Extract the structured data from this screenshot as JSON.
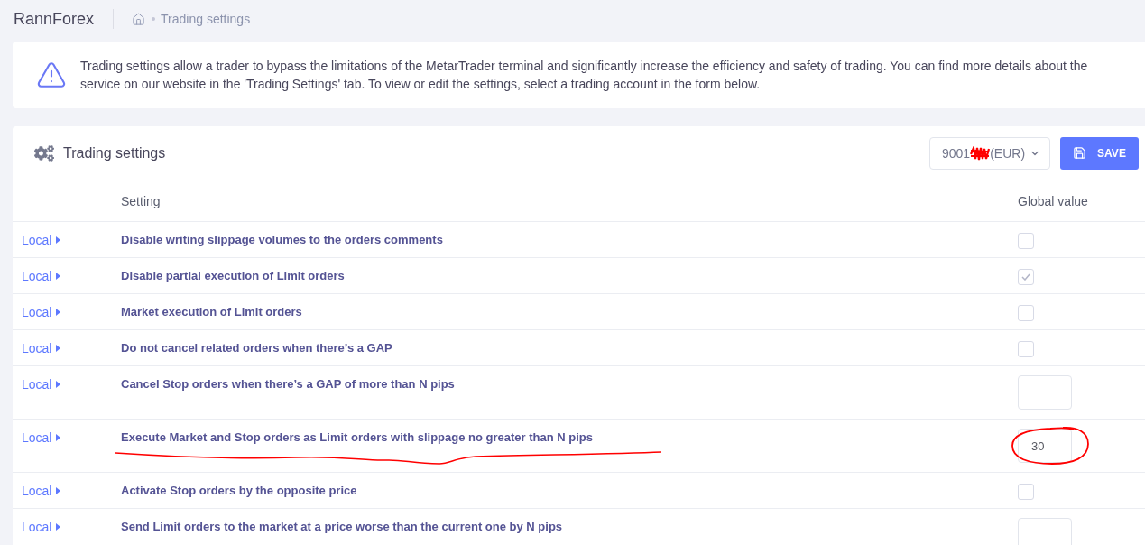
{
  "header": {
    "brand": "RannForex",
    "breadcrumb": [
      "Trading settings"
    ]
  },
  "alert": {
    "text": "Trading settings allow a trader to bypass the limitations of the MetarTrader terminal and significantly increase the efficiency and safety of trading. You can find more details about the service on our website in the 'Trading Settings' tab. To view or edit the settings, select a trading account in the form below."
  },
  "card": {
    "title": "Trading settings",
    "account": {
      "number": "9001",
      "redacted": true,
      "currency": "(EUR)"
    },
    "save_button": "SAVE"
  },
  "table": {
    "columns": [
      "Setting",
      "Global value"
    ],
    "rows": [
      {
        "scope": "Local",
        "label": "Disable writing slippage volumes to the orders comments",
        "kind": "checkbox",
        "checked": false,
        "annotated": false
      },
      {
        "scope": "Local",
        "label": "Disable partial execution of Limit orders",
        "kind": "checkbox",
        "checked": true,
        "annotated": false
      },
      {
        "scope": "Local",
        "label": "Market execution of Limit orders",
        "kind": "checkbox",
        "checked": false,
        "annotated": false
      },
      {
        "scope": "Local",
        "label": "Do not cancel related orders when there’s a GAP",
        "kind": "checkbox",
        "checked": false,
        "annotated": false
      },
      {
        "scope": "Local",
        "label": "Cancel Stop orders when there’s a GAP of more than N pips",
        "kind": "number",
        "annotated": false
      },
      {
        "scope": "Local",
        "label": "Execute Market and Stop orders as Limit orders with slippage no greater than N pips",
        "kind": "number",
        "value": "30",
        "annotated": true
      },
      {
        "scope": "Local",
        "label": "Activate Stop orders by the opposite price",
        "kind": "checkbox",
        "checked": false,
        "annotated": false
      },
      {
        "scope": "Local",
        "label": "Send Limit orders to the market at a price worse than the current one by N pips",
        "kind": "number",
        "annotated": false
      }
    ]
  }
}
